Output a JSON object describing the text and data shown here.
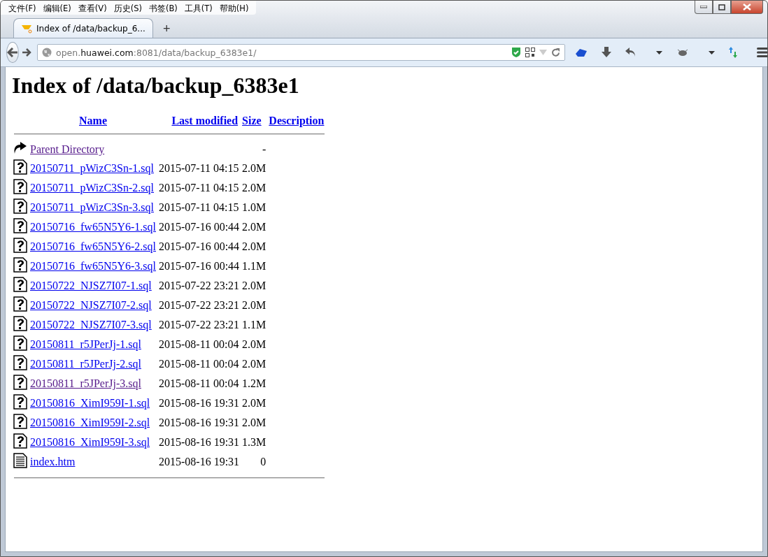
{
  "menu_bar": [
    "文件(F)",
    "编辑(E)",
    "查看(V)",
    "历史(S)",
    "书签(B)",
    "工具(T)",
    "帮助(H)"
  ],
  "tabs": [
    {
      "label": "Index of /data/backup_6...",
      "selected": true
    }
  ],
  "new_tab": "+",
  "address": {
    "prefix": "open.",
    "domain": "huawei.com",
    "suffix": ":8081/data/backup_6383e1/"
  },
  "page": {
    "heading": "Index of /data/backup_6383e1",
    "columns": [
      "Name",
      "Last modified",
      "Size",
      "Description"
    ],
    "rows": [
      {
        "kind": "parent",
        "name": "Parent Directory",
        "modified": "",
        "size": "-",
        "visited": true
      },
      {
        "kind": "unknown",
        "name": "20150711_pWizC3Sn-1.sql",
        "modified": "2015-07-11 04:15",
        "size": "2.0M",
        "visited": false
      },
      {
        "kind": "unknown",
        "name": "20150711_pWizC3Sn-2.sql",
        "modified": "2015-07-11 04:15",
        "size": "2.0M",
        "visited": false
      },
      {
        "kind": "unknown",
        "name": "20150711_pWizC3Sn-3.sql",
        "modified": "2015-07-11 04:15",
        "size": "1.0M",
        "visited": false
      },
      {
        "kind": "unknown",
        "name": "20150716_fw65N5Y6-1.sql",
        "modified": "2015-07-16 00:44",
        "size": "2.0M",
        "visited": false
      },
      {
        "kind": "unknown",
        "name": "20150716_fw65N5Y6-2.sql",
        "modified": "2015-07-16 00:44",
        "size": "2.0M",
        "visited": false
      },
      {
        "kind": "unknown",
        "name": "20150716_fw65N5Y6-3.sql",
        "modified": "2015-07-16 00:44",
        "size": "1.1M",
        "visited": false
      },
      {
        "kind": "unknown",
        "name": "20150722_NJSZ7I07-1.sql",
        "modified": "2015-07-22 23:21",
        "size": "2.0M",
        "visited": false
      },
      {
        "kind": "unknown",
        "name": "20150722_NJSZ7I07-2.sql",
        "modified": "2015-07-22 23:21",
        "size": "2.0M",
        "visited": false
      },
      {
        "kind": "unknown",
        "name": "20150722_NJSZ7I07-3.sql",
        "modified": "2015-07-22 23:21",
        "size": "1.1M",
        "visited": false
      },
      {
        "kind": "unknown",
        "name": "20150811_r5JPerJj-1.sql",
        "modified": "2015-08-11 00:04",
        "size": "2.0M",
        "visited": false
      },
      {
        "kind": "unknown",
        "name": "20150811_r5JPerJj-2.sql",
        "modified": "2015-08-11 00:04",
        "size": "2.0M",
        "visited": false
      },
      {
        "kind": "unknown",
        "name": "20150811_r5JPerJj-3.sql",
        "modified": "2015-08-11 00:04",
        "size": "1.2M",
        "visited": true
      },
      {
        "kind": "unknown",
        "name": "20150816_XimI959I-1.sql",
        "modified": "2015-08-16 19:31",
        "size": "2.0M",
        "visited": false
      },
      {
        "kind": "unknown",
        "name": "20150816_XimI959I-2.sql",
        "modified": "2015-08-16 19:31",
        "size": "2.0M",
        "visited": false
      },
      {
        "kind": "unknown",
        "name": "20150816_XimI959I-3.sql",
        "modified": "2015-08-16 19:31",
        "size": "1.3M",
        "visited": false
      },
      {
        "kind": "text",
        "name": "index.htm",
        "modified": "2015-08-16 19:31",
        "size": "0",
        "visited": false
      }
    ]
  }
}
